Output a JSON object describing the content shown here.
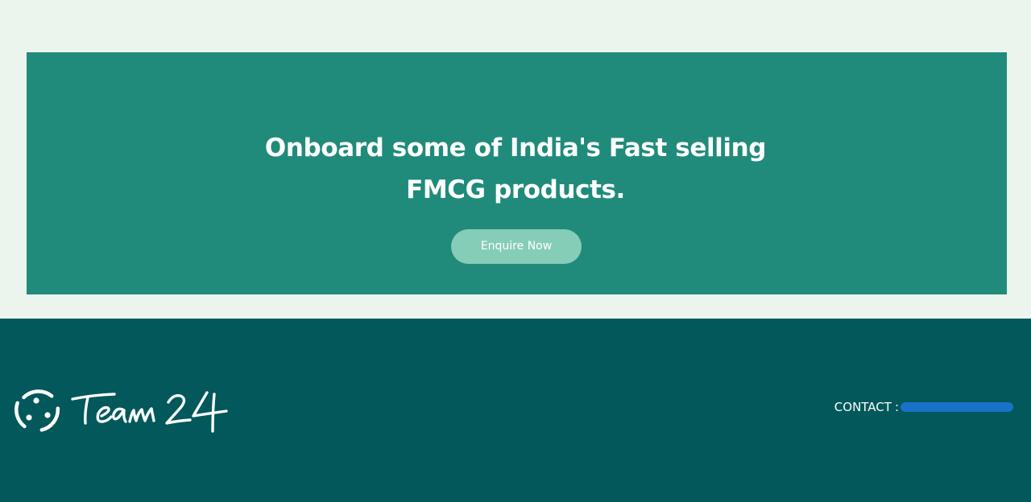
{
  "cta": {
    "headline_line1": "Onboard some of India's Fast selling",
    "headline_line2": "FMCG products.",
    "button_label": "Enquire Now"
  },
  "footer": {
    "brand_name": "Team 24",
    "contact_label": "CONTACT",
    "contact_separator": ":"
  },
  "colors": {
    "page_background": "#ebf5ee",
    "cta_background": "#208b7b",
    "button_background": "#86cdb8",
    "footer_background": "#02585a",
    "redaction": "#1872c8",
    "text": "#ffffff"
  },
  "icons": {
    "logo": "team-24-ring-logo-icon"
  }
}
